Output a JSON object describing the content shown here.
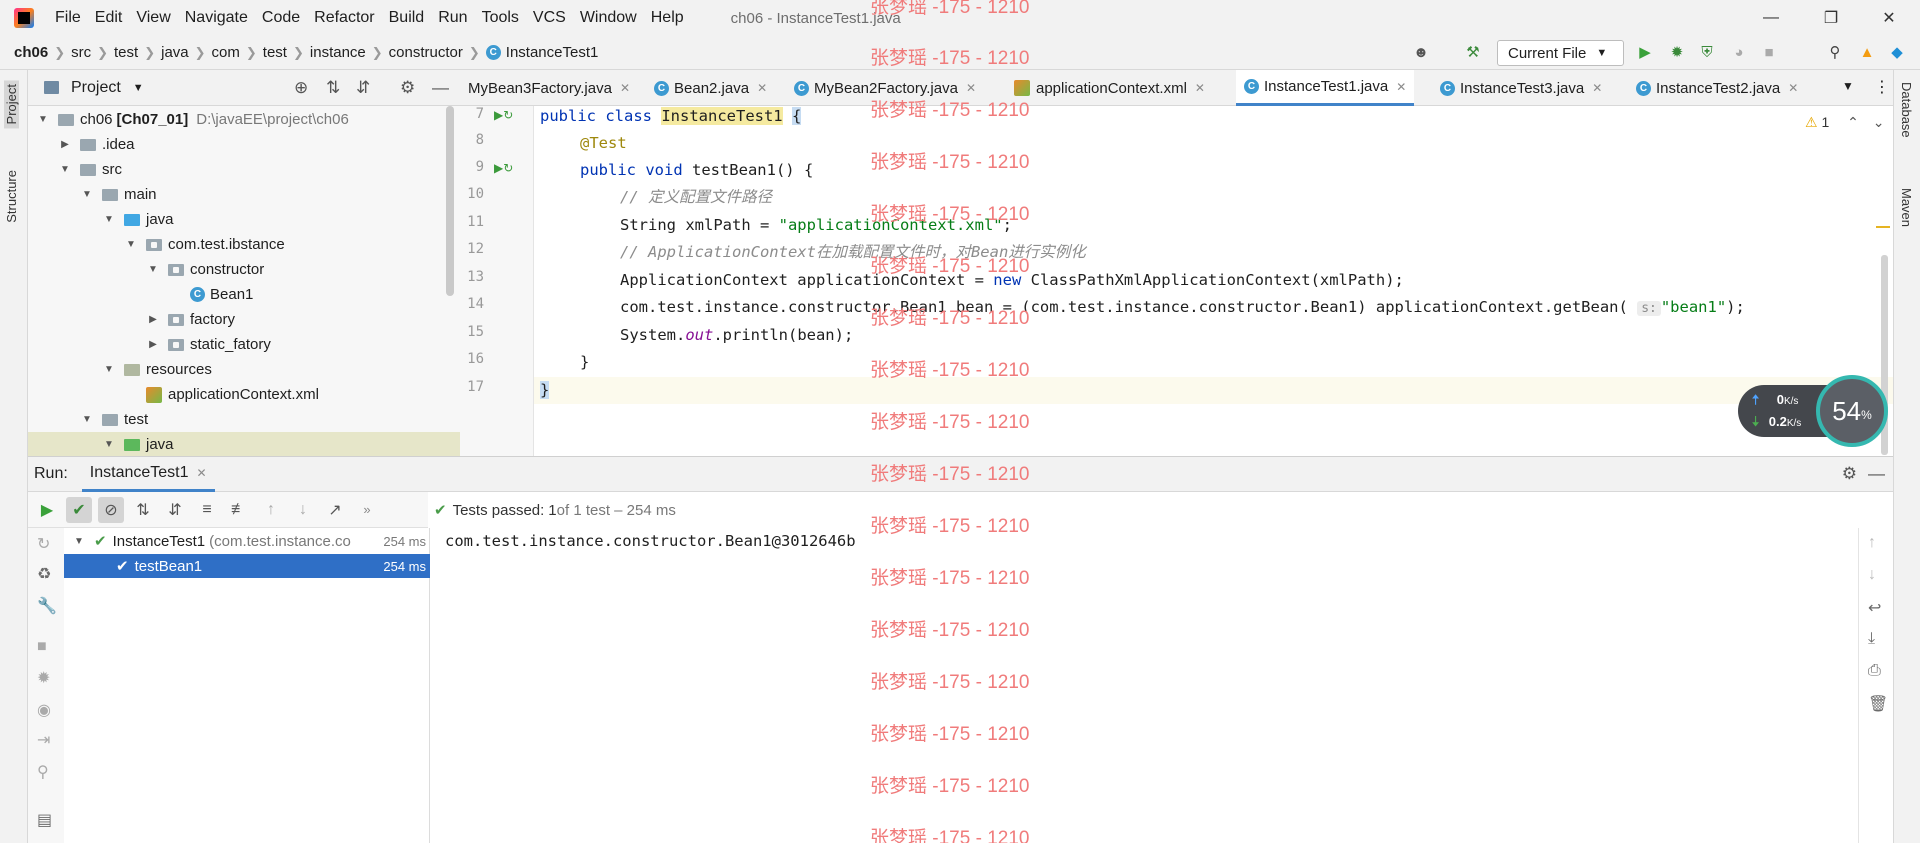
{
  "app": {
    "menu": [
      "File",
      "Edit",
      "View",
      "Navigate",
      "Code",
      "Refactor",
      "Build",
      "Run",
      "Tools",
      "VCS",
      "Window",
      "Help"
    ],
    "window_title": "ch06 - InstanceTest1.java"
  },
  "breadcrumb": {
    "items": [
      "ch06",
      "src",
      "test",
      "java",
      "com",
      "test",
      "instance",
      "constructor"
    ],
    "current": "InstanceTest1"
  },
  "toolbar": {
    "run_config": "Current File"
  },
  "left_strip": {
    "project_label": "Project",
    "structure_label": "Structure"
  },
  "right_strip": {
    "database_label": "Database",
    "maven_label": "Maven"
  },
  "project_panel": {
    "title": "Project",
    "tree": [
      {
        "label": "ch06",
        "extra": "[Ch07_01]",
        "path": "D:\\javaEE\\project\\ch06"
      },
      {
        "label": ".idea"
      },
      {
        "label": "src"
      },
      {
        "label": "main"
      },
      {
        "label": "java"
      },
      {
        "label": "com.test.ibstance"
      },
      {
        "label": "constructor"
      },
      {
        "label": "Bean1"
      },
      {
        "label": "factory"
      },
      {
        "label": "static_fatory"
      },
      {
        "label": "resources"
      },
      {
        "label": "applicationContext.xml"
      },
      {
        "label": "test"
      },
      {
        "label": "java"
      }
    ]
  },
  "editor_tabs": [
    {
      "label": "MyBean3Factory.java"
    },
    {
      "label": "Bean2.java"
    },
    {
      "label": "MyBean2Factory.java"
    },
    {
      "label": "applicationContext.xml"
    },
    {
      "label": "InstanceTest1.java",
      "active": true
    },
    {
      "label": "InstanceTest3.java"
    },
    {
      "label": "InstanceTest2.java"
    }
  ],
  "editor": {
    "line_numbers": [
      "7",
      "8",
      "9",
      "10",
      "11",
      "12",
      "13",
      "14",
      "15",
      "16",
      "17"
    ],
    "warnings_count": "1",
    "code": {
      "l7_kw": "public class ",
      "l7_name": "InstanceTest1",
      "l7_brace": "{",
      "l8": "@Test",
      "l9_kw": "public void ",
      "l9_rest": "testBean1() {",
      "l10": "// 定义配置文件路径",
      "l11_a": "String xmlPath = ",
      "l11_str": "\"applicationContext.xml\"",
      "l11_b": ";",
      "l12": "// ApplicationContext在加载配置文件时，对Bean进行实例化",
      "l13_a": "ApplicationContext applicationContext = ",
      "l13_kw": "new",
      "l13_b": " ClassPathXmlApplicationContext(xmlPath);",
      "l14_a": "com.test.instance.constructor.Bean1 bean = (com.test.instance.constructor.Bean1) applicationContext.getBean(",
      "l14_hint": "s:",
      "l14_str": "\"bean1\"",
      "l14_b": ");",
      "l15_a": "System.",
      "l15_out": "out",
      "l15_b": ".println(bean);",
      "l16": "}",
      "l17": "}"
    }
  },
  "net_widget": {
    "up": "0",
    "up_unit": "K/s",
    "down": "0.2",
    "down_unit": "K/s",
    "percent": "54",
    "percent_unit": "%"
  },
  "run_panel": {
    "label": "Run:",
    "tab": "InstanceTest1",
    "status_prefix": "Tests passed: ",
    "status_count": "1",
    "status_suffix": " of 1 test – 254 ms",
    "tests": [
      {
        "name": "InstanceTest1",
        "detail": "(com.test.instance.co",
        "duration": "254 ms"
      },
      {
        "name": "testBean1",
        "duration": "254 ms"
      }
    ],
    "console_output": "com.test.instance.constructor.Bean1@3012646b"
  },
  "watermark": "张梦瑶 -175 - 1210"
}
